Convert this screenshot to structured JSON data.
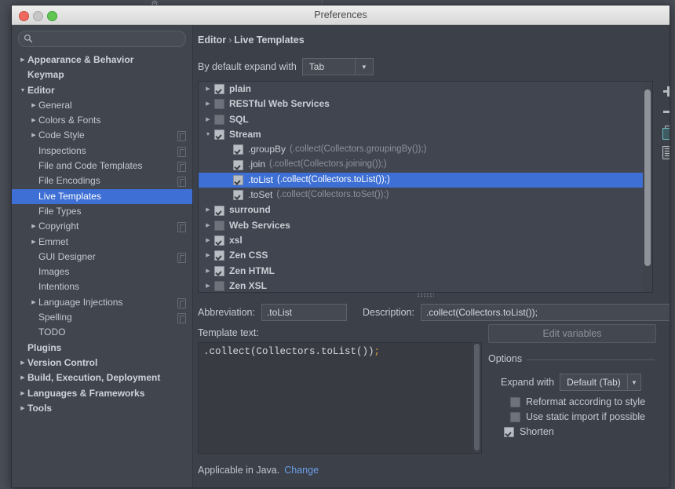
{
  "window": {
    "title": "Preferences",
    "traffic": [
      "close",
      "minimize",
      "zoom"
    ]
  },
  "search": {
    "value": "",
    "placeholder": "",
    "icon": "search-icon"
  },
  "sidebar": {
    "items": [
      {
        "label": "Appearance & Behavior",
        "indent": 0,
        "twisty": "right",
        "bold": true,
        "copy": false,
        "selected": false
      },
      {
        "label": "Keymap",
        "indent": 0,
        "twisty": "none",
        "bold": true,
        "copy": false,
        "selected": false
      },
      {
        "label": "Editor",
        "indent": 0,
        "twisty": "down",
        "bold": true,
        "copy": false,
        "selected": false
      },
      {
        "label": "General",
        "indent": 1,
        "twisty": "right",
        "bold": false,
        "copy": false,
        "selected": false
      },
      {
        "label": "Colors & Fonts",
        "indent": 1,
        "twisty": "right",
        "bold": false,
        "copy": false,
        "selected": false
      },
      {
        "label": "Code Style",
        "indent": 1,
        "twisty": "right",
        "bold": false,
        "copy": true,
        "selected": false
      },
      {
        "label": "Inspections",
        "indent": 1,
        "twisty": "none",
        "bold": false,
        "copy": true,
        "selected": false
      },
      {
        "label": "File and Code Templates",
        "indent": 1,
        "twisty": "none",
        "bold": false,
        "copy": true,
        "selected": false
      },
      {
        "label": "File Encodings",
        "indent": 1,
        "twisty": "none",
        "bold": false,
        "copy": true,
        "selected": false
      },
      {
        "label": "Live Templates",
        "indent": 1,
        "twisty": "none",
        "bold": false,
        "copy": false,
        "selected": true
      },
      {
        "label": "File Types",
        "indent": 1,
        "twisty": "none",
        "bold": false,
        "copy": false,
        "selected": false
      },
      {
        "label": "Copyright",
        "indent": 1,
        "twisty": "right",
        "bold": false,
        "copy": true,
        "selected": false
      },
      {
        "label": "Emmet",
        "indent": 1,
        "twisty": "right",
        "bold": false,
        "copy": false,
        "selected": false
      },
      {
        "label": "GUI Designer",
        "indent": 1,
        "twisty": "none",
        "bold": false,
        "copy": true,
        "selected": false
      },
      {
        "label": "Images",
        "indent": 1,
        "twisty": "none",
        "bold": false,
        "copy": false,
        "selected": false
      },
      {
        "label": "Intentions",
        "indent": 1,
        "twisty": "none",
        "bold": false,
        "copy": false,
        "selected": false
      },
      {
        "label": "Language Injections",
        "indent": 1,
        "twisty": "right",
        "bold": false,
        "copy": true,
        "selected": false
      },
      {
        "label": "Spelling",
        "indent": 1,
        "twisty": "none",
        "bold": false,
        "copy": true,
        "selected": false
      },
      {
        "label": "TODO",
        "indent": 1,
        "twisty": "none",
        "bold": false,
        "copy": false,
        "selected": false
      },
      {
        "label": "Plugins",
        "indent": 0,
        "twisty": "none",
        "bold": true,
        "copy": false,
        "selected": false
      },
      {
        "label": "Version Control",
        "indent": 0,
        "twisty": "right",
        "bold": true,
        "copy": false,
        "selected": false
      },
      {
        "label": "Build, Execution, Deployment",
        "indent": 0,
        "twisty": "right",
        "bold": true,
        "copy": false,
        "selected": false
      },
      {
        "label": "Languages & Frameworks",
        "indent": 0,
        "twisty": "right",
        "bold": true,
        "copy": false,
        "selected": false
      },
      {
        "label": "Tools",
        "indent": 0,
        "twisty": "right",
        "bold": true,
        "copy": false,
        "selected": false
      }
    ]
  },
  "main": {
    "breadcrumb": {
      "parent": "Editor",
      "separator": "›",
      "current": "Live Templates"
    },
    "expand_default": {
      "label": "By default expand with",
      "value": "Tab"
    },
    "templates": [
      {
        "name": "plain",
        "desc": "",
        "indent": 0,
        "twisty": "right",
        "checked": true,
        "selected": false
      },
      {
        "name": "RESTful Web Services",
        "desc": "",
        "indent": 0,
        "twisty": "right",
        "checked": false,
        "selected": false
      },
      {
        "name": "SQL",
        "desc": "",
        "indent": 0,
        "twisty": "right",
        "checked": false,
        "selected": false
      },
      {
        "name": "Stream",
        "desc": "",
        "indent": 0,
        "twisty": "down",
        "checked": true,
        "selected": false
      },
      {
        "name": ".groupBy",
        "desc": "(.collect(Collectors.groupingBy());)",
        "indent": 1,
        "twisty": "none",
        "checked": true,
        "selected": false
      },
      {
        "name": ".join",
        "desc": "(.collect(Collectors.joining());)",
        "indent": 1,
        "twisty": "none",
        "checked": true,
        "selected": false
      },
      {
        "name": ".toList",
        "desc": "(.collect(Collectors.toList());)",
        "indent": 1,
        "twisty": "none",
        "checked": true,
        "selected": true
      },
      {
        "name": ".toSet",
        "desc": "(.collect(Collectors.toSet());)",
        "indent": 1,
        "twisty": "none",
        "checked": true,
        "selected": false
      },
      {
        "name": "surround",
        "desc": "",
        "indent": 0,
        "twisty": "right",
        "checked": true,
        "selected": false
      },
      {
        "name": "Web Services",
        "desc": "",
        "indent": 0,
        "twisty": "right",
        "checked": false,
        "selected": false
      },
      {
        "name": "xsl",
        "desc": "",
        "indent": 0,
        "twisty": "right",
        "checked": true,
        "selected": false
      },
      {
        "name": "Zen CSS",
        "desc": "",
        "indent": 0,
        "twisty": "right",
        "checked": true,
        "selected": false
      },
      {
        "name": "Zen HTML",
        "desc": "",
        "indent": 0,
        "twisty": "right",
        "checked": true,
        "selected": false
      },
      {
        "name": "Zen XSL",
        "desc": "",
        "indent": 0,
        "twisty": "right",
        "checked": false,
        "selected": false
      }
    ],
    "toolbar": [
      {
        "icon": "plus-icon",
        "name": "add-template-button"
      },
      {
        "icon": "minus-icon",
        "name": "remove-template-button"
      },
      {
        "icon": "copy-icon",
        "name": "duplicate-template-button"
      },
      {
        "icon": "list-icon",
        "name": "template-group-button"
      }
    ],
    "abbreviation": {
      "label": "Abbreviation:",
      "value": ".toList"
    },
    "description": {
      "label": "Description:",
      "value": ".collect(Collectors.toList());"
    },
    "template_text": {
      "label": "Template text:",
      "code": ".collect(Collectors.toList())",
      "code_tail": ";"
    },
    "edit_variables_label": "Edit variables",
    "options": {
      "legend": "Options",
      "expand_with": {
        "label": "Expand with",
        "value": "Default (Tab)"
      },
      "checkboxes": [
        {
          "label": "Reformat according to style",
          "checked": false
        },
        {
          "label": "Use static import if possible",
          "checked": false
        },
        {
          "label": "Shorten",
          "checked": true
        }
      ]
    },
    "applicable": {
      "text": "Applicable in Java.",
      "link": "Change"
    }
  },
  "colors": {
    "accent_selection": "#3d6fd4",
    "window_bg": "#3c4049",
    "sidebar_bg": "#41454e",
    "link": "#6c9ee8",
    "code_punct": "#d9a441"
  }
}
